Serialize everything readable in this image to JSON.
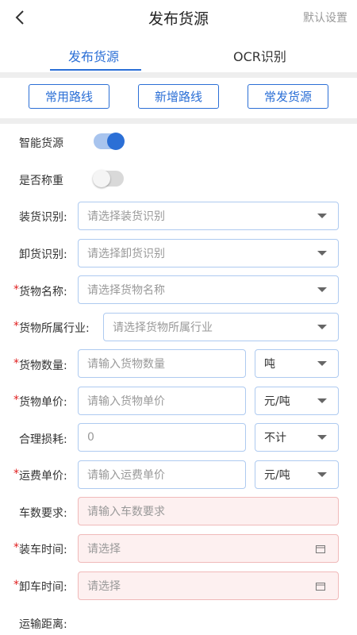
{
  "header": {
    "title": "发布货源",
    "right_action": "默认设置"
  },
  "tabs": [
    {
      "label": "发布货源",
      "active": true
    },
    {
      "label": "OCR识别",
      "active": false
    }
  ],
  "route_buttons": [
    "常用路线",
    "新增路线",
    "常发货源"
  ],
  "toggles": {
    "smart": {
      "label": "智能货源",
      "on": true
    },
    "weigh": {
      "label": "是否称重",
      "on": false
    }
  },
  "form": {
    "load_id": {
      "label": "装货识别:",
      "placeholder": "请选择装货识别"
    },
    "unload_id": {
      "label": "卸货识别:",
      "placeholder": "请选择卸货识别"
    },
    "goods_name": {
      "label": "货物名称:",
      "placeholder": "请选择货物名称",
      "required": "*"
    },
    "goods_industry": {
      "label": "货物所属行业:",
      "placeholder": "请选择货物所属行业",
      "required": "*"
    },
    "goods_qty": {
      "label": "货物数量:",
      "placeholder": "请输入货物数量",
      "unit": "吨",
      "required": "*"
    },
    "goods_price": {
      "label": "货物单价:",
      "placeholder": "请输入货物单价",
      "unit": "元/吨",
      "required": "*"
    },
    "loss": {
      "label": "合理损耗:",
      "value": "0",
      "unit": "不计"
    },
    "freight_price": {
      "label": "运费单价:",
      "placeholder": "请输入运费单价",
      "unit": "元/吨",
      "required": "*"
    },
    "vehicle_req": {
      "label": "车数要求:",
      "placeholder": "请输入车数要求"
    },
    "load_time": {
      "label": "装车时间:",
      "placeholder": "请选择",
      "required": "*"
    },
    "unload_time": {
      "label": "卸车时间:",
      "placeholder": "请选择",
      "required": "*"
    },
    "distance": {
      "label": "运输距离:"
    }
  },
  "colors": {
    "accent": "#2b6fd6",
    "required": "#e02020",
    "field_border": "#aecaf0",
    "pink_bg": "#fdf0f0"
  }
}
